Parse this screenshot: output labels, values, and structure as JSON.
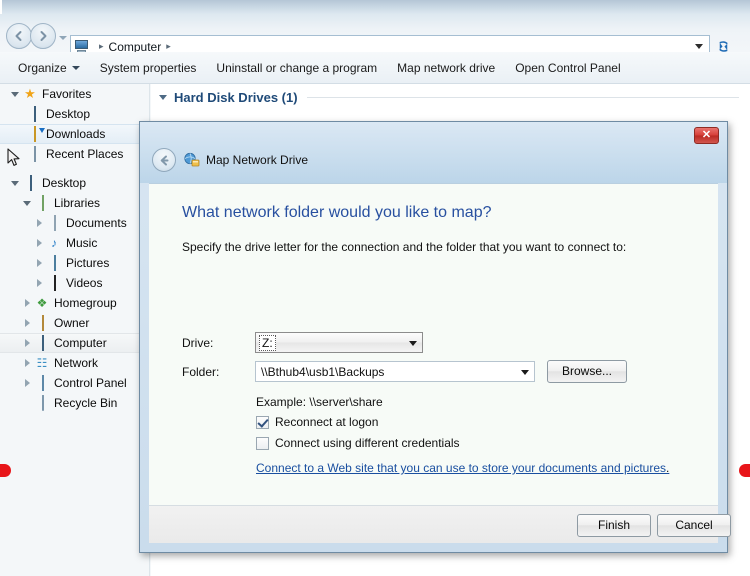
{
  "explorer": {
    "address_bar": {
      "back_icon": "back-arrow-icon",
      "forward_icon": "forward-arrow-icon",
      "history_icon": "chevron-down-icon",
      "computer_icon": "computer-icon",
      "breadcrumb": [
        {
          "label": "Computer"
        }
      ],
      "separator": "▸",
      "dropdown_icon": "chevron-down-icon",
      "refresh_icon": "refresh-icon",
      "refresh_glyph": "↻"
    },
    "command_bar": {
      "items": [
        {
          "label": "Organize",
          "has_caret": true
        },
        {
          "label": "System properties",
          "has_caret": false
        },
        {
          "label": "Uninstall or change a program",
          "has_caret": false
        },
        {
          "label": "Map network drive",
          "has_caret": false
        },
        {
          "label": "Open Control Panel",
          "has_caret": false
        }
      ]
    },
    "nav_pane": {
      "groups": [
        {
          "items": [
            {
              "label": "Favorites",
              "icon": "star-icon",
              "indent": 0,
              "twisty": "open",
              "state": "normal"
            },
            {
              "label": "Desktop",
              "icon": "monitor-icon",
              "indent": 1,
              "twisty": "none",
              "state": "normal"
            },
            {
              "label": "Downloads",
              "icon": "downloads-folder-icon",
              "indent": 1,
              "twisty": "none",
              "state": "selected"
            },
            {
              "label": "Recent Places",
              "icon": "recent-places-icon",
              "indent": 1,
              "twisty": "none",
              "state": "normal"
            }
          ]
        },
        {
          "items": [
            {
              "label": "Desktop",
              "icon": "monitor-icon",
              "indent": 0,
              "twisty": "open",
              "state": "normal"
            },
            {
              "label": "Libraries",
              "icon": "libraries-folder-icon",
              "indent": 1,
              "twisty": "open",
              "state": "normal"
            },
            {
              "label": "Documents",
              "icon": "document-icon",
              "indent": 2,
              "twisty": "closed",
              "state": "normal"
            },
            {
              "label": "Music",
              "icon": "music-note-icon",
              "indent": 2,
              "twisty": "closed",
              "state": "normal"
            },
            {
              "label": "Pictures",
              "icon": "picture-icon",
              "indent": 2,
              "twisty": "closed",
              "state": "normal"
            },
            {
              "label": "Videos",
              "icon": "video-icon",
              "indent": 2,
              "twisty": "closed",
              "state": "normal"
            },
            {
              "label": "Homegroup",
              "icon": "homegroup-icon",
              "indent": 1,
              "twisty": "closed",
              "state": "normal"
            },
            {
              "label": "Owner",
              "icon": "user-folder-icon",
              "indent": 1,
              "twisty": "closed",
              "state": "normal"
            },
            {
              "label": "Computer",
              "icon": "computer-icon",
              "indent": 1,
              "twisty": "closed",
              "state": "highlighted"
            },
            {
              "label": "Network",
              "icon": "network-icon",
              "indent": 1,
              "twisty": "closed",
              "state": "normal"
            },
            {
              "label": "Control Panel",
              "icon": "control-panel-icon",
              "indent": 1,
              "twisty": "closed",
              "state": "normal"
            },
            {
              "label": "Recycle Bin",
              "icon": "recycle-bin-icon",
              "indent": 2,
              "twisty": "none",
              "state": "normal"
            }
          ]
        }
      ]
    },
    "content": {
      "group_header": "Hard Disk Drives (1)"
    },
    "cursor_icon": "mouse-pointer-icon"
  },
  "dialog": {
    "title": "Map Network Drive",
    "title_icon": "map-network-drive-icon",
    "back_icon": "back-arrow-icon",
    "back_glyph": "←",
    "close_label": "✕",
    "heading": "What network folder would you like to map?",
    "subheading": "Specify the drive letter for the connection and the folder that you want to connect to:",
    "drive": {
      "label": "Drive:",
      "value": "Z:",
      "dropdown_icon": "chevron-down-icon"
    },
    "folder": {
      "label": "Folder:",
      "value": "\\\\Bthub4\\usb1\\Backups",
      "placeholder": "",
      "dropdown_icon": "chevron-down-icon"
    },
    "browse_button": "Browse...",
    "example_text": "Example: \\\\server\\share",
    "checkboxes": [
      {
        "label": "Reconnect at logon",
        "checked": true
      },
      {
        "label": "Connect using different credentials",
        "checked": false
      }
    ],
    "link": {
      "text": "Connect to a Web site that you can use to store your documents and pictures",
      "trailing": "."
    },
    "footer": {
      "finish_label": "Finish",
      "cancel_label": "Cancel"
    }
  },
  "annotations": {
    "marker_color": "#e8161a",
    "markers": [
      {
        "side": "left"
      },
      {
        "side": "right"
      }
    ]
  },
  "colors": {
    "accent_blue": "#2850a0",
    "link_blue": "#1a4fa0",
    "group_header_blue": "#1f4a78",
    "close_red": "#d63f38",
    "marker_red": "#e8161a"
  }
}
